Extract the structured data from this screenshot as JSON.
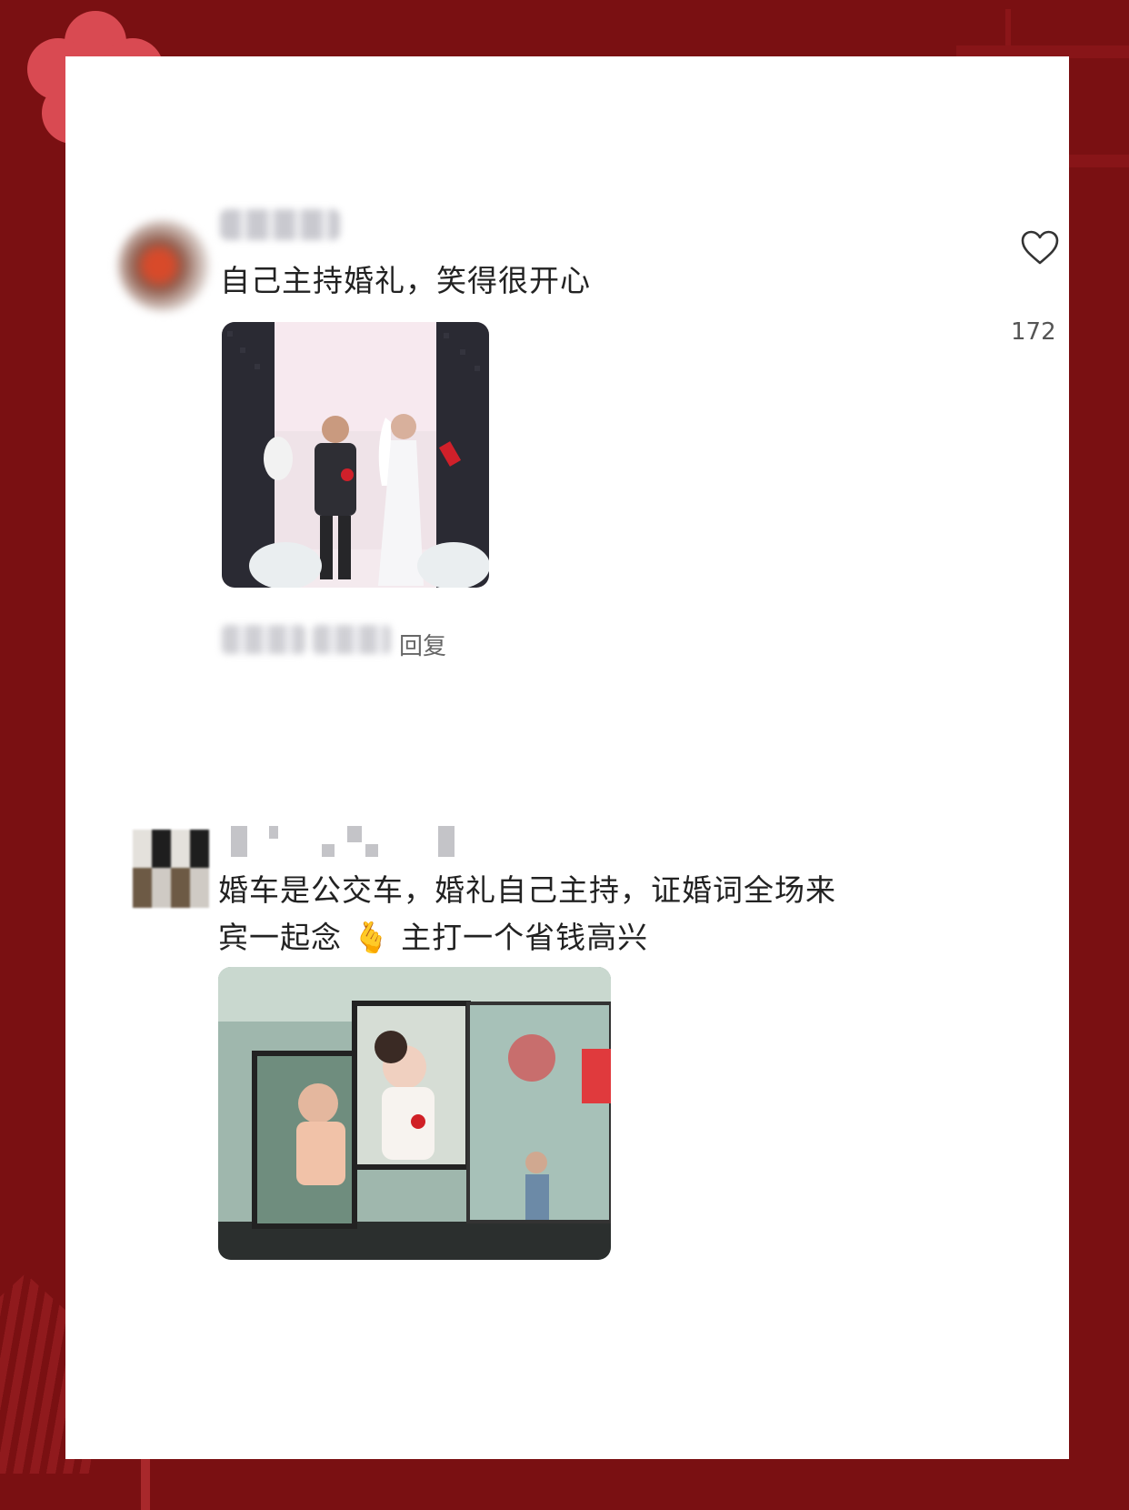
{
  "comments": [
    {
      "text": "自己主持婚礼，笑得很开心",
      "like_count": "172",
      "reply_label": "回复",
      "photo": "wedding-stage-photo"
    },
    {
      "text_line1": "婚车是公交车，婚礼自己主持，证婚词全场来",
      "text_line2_a": "宾一起念",
      "emoji": "🫰",
      "text_line2_b": "主打一个省钱高兴",
      "photo": "bus-window-photo"
    }
  ],
  "colors": {
    "background": "#7a1012",
    "card": "#ffffff",
    "flower": "#d94a52",
    "flower_center": "#f3c43c"
  }
}
